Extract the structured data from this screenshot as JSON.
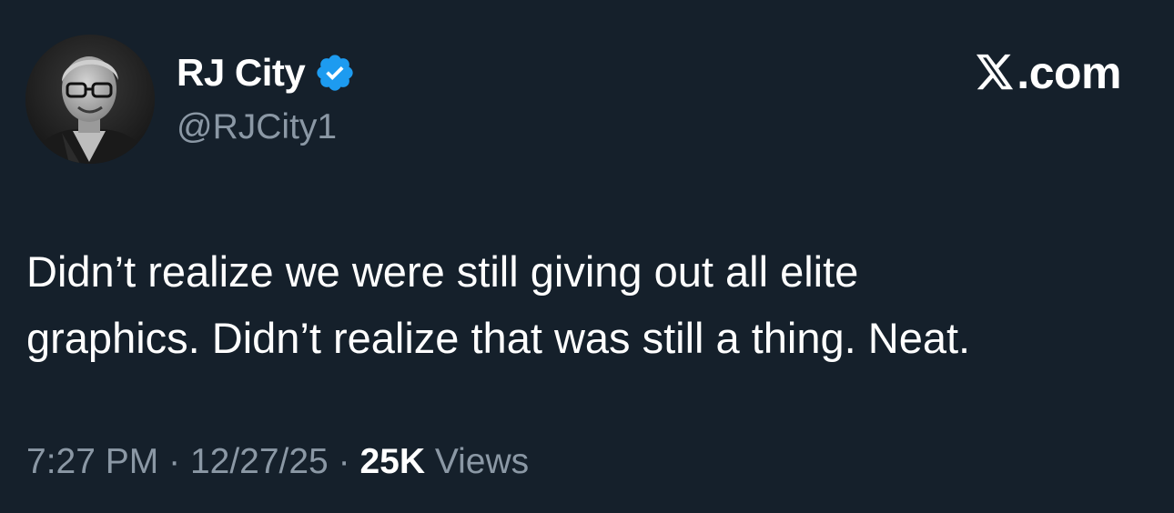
{
  "author": {
    "display_name": "RJ City",
    "handle": "@RJCity1",
    "verified": true
  },
  "brand": {
    "label": ".com",
    "icon": "x-logo-icon"
  },
  "tweet": {
    "lines": [
      "Didn’t realize we were still giving out all elite",
      "graphics. Didn’t realize that was still a thing. Neat."
    ]
  },
  "meta": {
    "time": "7:27 PM",
    "separator": "·",
    "date": "12/27/25",
    "views_count": "25K",
    "views_label": "Views"
  },
  "colors": {
    "background": "#15202b",
    "text_primary": "#ffffff",
    "text_secondary": "#8b98a5",
    "verified_blue": "#1d9bf0"
  }
}
